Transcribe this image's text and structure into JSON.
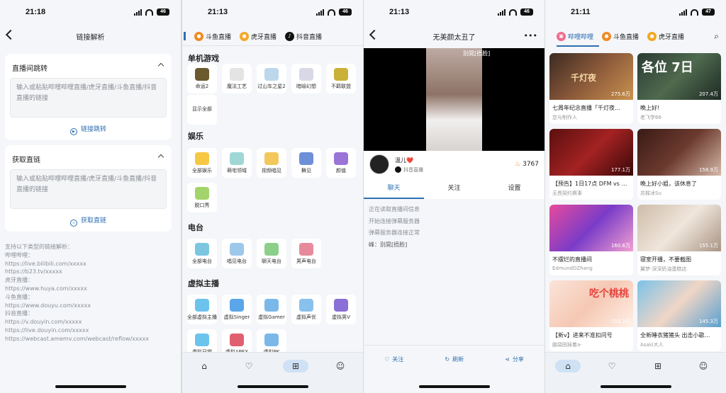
{
  "p1": {
    "time": "21:18",
    "battery": "46",
    "title": "链接解析",
    "card1": {
      "header": "直播间跳转",
      "placeholder": "输入或粘贴哔哩哔哩直播/虎牙直播/斗鱼直播/抖音直播的链接",
      "action": "链接跳转"
    },
    "card2": {
      "header": "获取直链",
      "placeholder": "输入或粘贴哔哩哔哩直播/虎牙直播/斗鱼直播/抖音直播的链接",
      "action": "获取直链"
    },
    "help": [
      "支持以下类型的链接解析：",
      "哔哩哔哩：",
      "https://live.bilibili.com/xxxxx",
      "https://b23.tv/xxxxx",
      "虎牙直播：",
      "https://www.huya.com/xxxxx",
      "斗鱼直播：",
      "https://www.douyu.com/xxxxx",
      "抖音直播：",
      "https://v.douyin.com/xxxxx",
      "https://live.douyin.com/xxxxx",
      "https://webcast.amemv.com/webcast/reflow/xxxxx"
    ]
  },
  "p2": {
    "time": "21:13",
    "battery": "46",
    "tabs": [
      "斗鱼直播",
      "虎牙直播",
      "抖音直播"
    ],
    "sections": [
      "单机游戏",
      "娱乐",
      "电台",
      "虚拟主播"
    ],
    "games": [
      "命运2",
      "魔法工艺",
      "过山车之星2",
      "暗喻幻想",
      "不羁联盟",
      "显示全部"
    ],
    "ent": [
      "全部娱乐",
      "萌宅领域",
      "视频唱见",
      "舞见",
      "颜值",
      "脱口秀"
    ],
    "radio": [
      "全部电台",
      "唱见电台",
      "聊天电台",
      "男声电台"
    ],
    "vtuber": [
      "全部虚拟主播",
      "虚拟Singer",
      "虚拟Gamer",
      "虚拟声优",
      "虚拟男V",
      "虚拟日常",
      "虚拟APEX",
      "虚拟PK"
    ]
  },
  "p3": {
    "time": "21:13",
    "battery": "46",
    "title": "无美颜太丑了",
    "video_tag": "别晃[捂脸]",
    "host": "温儿❤️",
    "platform": "抖音直播",
    "heat": "3767",
    "tabs": [
      "聊天",
      "关注",
      "设置"
    ],
    "messages": [
      "正在读取直播间信息",
      "开始连接弹幕服务器",
      "弹幕服务器连接正常",
      "峰：别晃[捂脸]"
    ],
    "actions": [
      "关注",
      "刷新",
      "分享"
    ]
  },
  "p4": {
    "time": "21:11",
    "battery": "47",
    "tabs": [
      "哔哩哔哩",
      "斗鱼直播",
      "虎牙直播"
    ],
    "cards": [
      {
        "title": "七周年纪念直播「千灯夜…",
        "sub": "恋与制作人",
        "views": "275.6万"
      },
      {
        "title": "晚上好!",
        "sub": "老飞学66",
        "views": "207.4万"
      },
      {
        "title": "【预告】1日17点 DFM vs …",
        "sub": "无畏契约赛事",
        "views": "177.1万"
      },
      {
        "title": "晚上好小姐，该休息了",
        "sub": "苏樑冰Su",
        "views": "158.9万"
      },
      {
        "title": "不摆烂的直播间",
        "sub": "EdmundDZhang",
        "views": "160.6万"
      },
      {
        "title": "寝室开播，不要截图",
        "sub": "翼梦-深深奶油蛋糕店",
        "views": "155.1万"
      },
      {
        "title": "【新v】进来不准扣问号",
        "sub": "脑袋困掉着a-",
        "views": "151.3万"
      },
      {
        "title": "全新睡衣猪猪头 出击小歌…",
        "sub": "Asaki大人",
        "views": "145.3万"
      }
    ],
    "thumb_text": [
      "千灯夜",
      "各位 7日",
      "",
      "",
      "",
      "",
      "吃个桃桃",
      ""
    ]
  }
}
